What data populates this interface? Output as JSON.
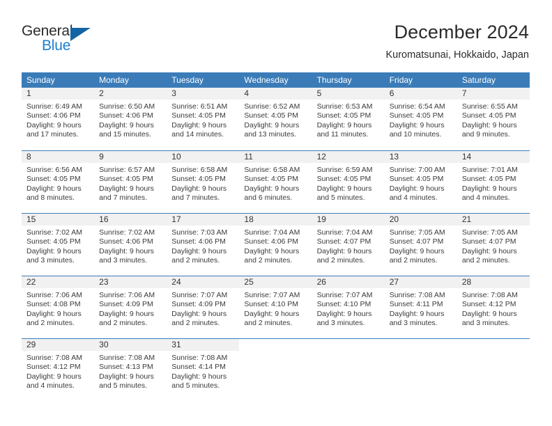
{
  "brand": {
    "name_top": "General",
    "name_bottom": "Blue",
    "accent_color": "#1c7fd4",
    "triangle_color": "#1464a5"
  },
  "header": {
    "title": "December 2024",
    "subtitle": "Kuromatsunai, Hokkaido, Japan"
  },
  "calendar": {
    "header_bg": "#3b7cb8",
    "daynum_bg": "#f1f1f1",
    "weekdays": [
      "Sunday",
      "Monday",
      "Tuesday",
      "Wednesday",
      "Thursday",
      "Friday",
      "Saturday"
    ],
    "weeks": [
      [
        {
          "day": "1",
          "sunrise": "Sunrise: 6:49 AM",
          "sunset": "Sunset: 4:06 PM",
          "daylight1": "Daylight: 9 hours",
          "daylight2": "and 17 minutes."
        },
        {
          "day": "2",
          "sunrise": "Sunrise: 6:50 AM",
          "sunset": "Sunset: 4:06 PM",
          "daylight1": "Daylight: 9 hours",
          "daylight2": "and 15 minutes."
        },
        {
          "day": "3",
          "sunrise": "Sunrise: 6:51 AM",
          "sunset": "Sunset: 4:05 PM",
          "daylight1": "Daylight: 9 hours",
          "daylight2": "and 14 minutes."
        },
        {
          "day": "4",
          "sunrise": "Sunrise: 6:52 AM",
          "sunset": "Sunset: 4:05 PM",
          "daylight1": "Daylight: 9 hours",
          "daylight2": "and 13 minutes."
        },
        {
          "day": "5",
          "sunrise": "Sunrise: 6:53 AM",
          "sunset": "Sunset: 4:05 PM",
          "daylight1": "Daylight: 9 hours",
          "daylight2": "and 11 minutes."
        },
        {
          "day": "6",
          "sunrise": "Sunrise: 6:54 AM",
          "sunset": "Sunset: 4:05 PM",
          "daylight1": "Daylight: 9 hours",
          "daylight2": "and 10 minutes."
        },
        {
          "day": "7",
          "sunrise": "Sunrise: 6:55 AM",
          "sunset": "Sunset: 4:05 PM",
          "daylight1": "Daylight: 9 hours",
          "daylight2": "and 9 minutes."
        }
      ],
      [
        {
          "day": "8",
          "sunrise": "Sunrise: 6:56 AM",
          "sunset": "Sunset: 4:05 PM",
          "daylight1": "Daylight: 9 hours",
          "daylight2": "and 8 minutes."
        },
        {
          "day": "9",
          "sunrise": "Sunrise: 6:57 AM",
          "sunset": "Sunset: 4:05 PM",
          "daylight1": "Daylight: 9 hours",
          "daylight2": "and 7 minutes."
        },
        {
          "day": "10",
          "sunrise": "Sunrise: 6:58 AM",
          "sunset": "Sunset: 4:05 PM",
          "daylight1": "Daylight: 9 hours",
          "daylight2": "and 7 minutes."
        },
        {
          "day": "11",
          "sunrise": "Sunrise: 6:58 AM",
          "sunset": "Sunset: 4:05 PM",
          "daylight1": "Daylight: 9 hours",
          "daylight2": "and 6 minutes."
        },
        {
          "day": "12",
          "sunrise": "Sunrise: 6:59 AM",
          "sunset": "Sunset: 4:05 PM",
          "daylight1": "Daylight: 9 hours",
          "daylight2": "and 5 minutes."
        },
        {
          "day": "13",
          "sunrise": "Sunrise: 7:00 AM",
          "sunset": "Sunset: 4:05 PM",
          "daylight1": "Daylight: 9 hours",
          "daylight2": "and 4 minutes."
        },
        {
          "day": "14",
          "sunrise": "Sunrise: 7:01 AM",
          "sunset": "Sunset: 4:05 PM",
          "daylight1": "Daylight: 9 hours",
          "daylight2": "and 4 minutes."
        }
      ],
      [
        {
          "day": "15",
          "sunrise": "Sunrise: 7:02 AM",
          "sunset": "Sunset: 4:05 PM",
          "daylight1": "Daylight: 9 hours",
          "daylight2": "and 3 minutes."
        },
        {
          "day": "16",
          "sunrise": "Sunrise: 7:02 AM",
          "sunset": "Sunset: 4:06 PM",
          "daylight1": "Daylight: 9 hours",
          "daylight2": "and 3 minutes."
        },
        {
          "day": "17",
          "sunrise": "Sunrise: 7:03 AM",
          "sunset": "Sunset: 4:06 PM",
          "daylight1": "Daylight: 9 hours",
          "daylight2": "and 2 minutes."
        },
        {
          "day": "18",
          "sunrise": "Sunrise: 7:04 AM",
          "sunset": "Sunset: 4:06 PM",
          "daylight1": "Daylight: 9 hours",
          "daylight2": "and 2 minutes."
        },
        {
          "day": "19",
          "sunrise": "Sunrise: 7:04 AM",
          "sunset": "Sunset: 4:07 PM",
          "daylight1": "Daylight: 9 hours",
          "daylight2": "and 2 minutes."
        },
        {
          "day": "20",
          "sunrise": "Sunrise: 7:05 AM",
          "sunset": "Sunset: 4:07 PM",
          "daylight1": "Daylight: 9 hours",
          "daylight2": "and 2 minutes."
        },
        {
          "day": "21",
          "sunrise": "Sunrise: 7:05 AM",
          "sunset": "Sunset: 4:07 PM",
          "daylight1": "Daylight: 9 hours",
          "daylight2": "and 2 minutes."
        }
      ],
      [
        {
          "day": "22",
          "sunrise": "Sunrise: 7:06 AM",
          "sunset": "Sunset: 4:08 PM",
          "daylight1": "Daylight: 9 hours",
          "daylight2": "and 2 minutes."
        },
        {
          "day": "23",
          "sunrise": "Sunrise: 7:06 AM",
          "sunset": "Sunset: 4:09 PM",
          "daylight1": "Daylight: 9 hours",
          "daylight2": "and 2 minutes."
        },
        {
          "day": "24",
          "sunrise": "Sunrise: 7:07 AM",
          "sunset": "Sunset: 4:09 PM",
          "daylight1": "Daylight: 9 hours",
          "daylight2": "and 2 minutes."
        },
        {
          "day": "25",
          "sunrise": "Sunrise: 7:07 AM",
          "sunset": "Sunset: 4:10 PM",
          "daylight1": "Daylight: 9 hours",
          "daylight2": "and 2 minutes."
        },
        {
          "day": "26",
          "sunrise": "Sunrise: 7:07 AM",
          "sunset": "Sunset: 4:10 PM",
          "daylight1": "Daylight: 9 hours",
          "daylight2": "and 3 minutes."
        },
        {
          "day": "27",
          "sunrise": "Sunrise: 7:08 AM",
          "sunset": "Sunset: 4:11 PM",
          "daylight1": "Daylight: 9 hours",
          "daylight2": "and 3 minutes."
        },
        {
          "day": "28",
          "sunrise": "Sunrise: 7:08 AM",
          "sunset": "Sunset: 4:12 PM",
          "daylight1": "Daylight: 9 hours",
          "daylight2": "and 3 minutes."
        }
      ],
      [
        {
          "day": "29",
          "sunrise": "Sunrise: 7:08 AM",
          "sunset": "Sunset: 4:12 PM",
          "daylight1": "Daylight: 9 hours",
          "daylight2": "and 4 minutes."
        },
        {
          "day": "30",
          "sunrise": "Sunrise: 7:08 AM",
          "sunset": "Sunset: 4:13 PM",
          "daylight1": "Daylight: 9 hours",
          "daylight2": "and 5 minutes."
        },
        {
          "day": "31",
          "sunrise": "Sunrise: 7:08 AM",
          "sunset": "Sunset: 4:14 PM",
          "daylight1": "Daylight: 9 hours",
          "daylight2": "and 5 minutes."
        },
        {
          "day": "",
          "sunrise": "",
          "sunset": "",
          "daylight1": "",
          "daylight2": ""
        },
        {
          "day": "",
          "sunrise": "",
          "sunset": "",
          "daylight1": "",
          "daylight2": ""
        },
        {
          "day": "",
          "sunrise": "",
          "sunset": "",
          "daylight1": "",
          "daylight2": ""
        },
        {
          "day": "",
          "sunrise": "",
          "sunset": "",
          "daylight1": "",
          "daylight2": ""
        }
      ]
    ]
  }
}
